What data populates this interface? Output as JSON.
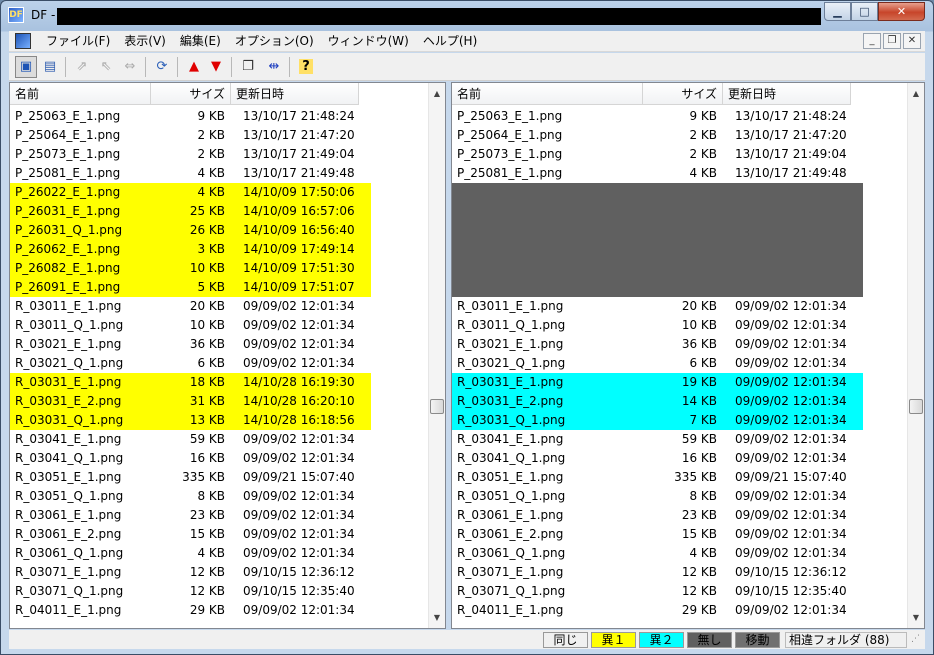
{
  "window": {
    "title": "DF -"
  },
  "menu": [
    "ファイル(F)",
    "表示(V)",
    "編集(E)",
    "オプション(O)",
    "ウィンドウ(W)",
    "ヘルプ(H)"
  ],
  "columns": {
    "name": "名前",
    "size": "サイズ",
    "date": "更新日時"
  },
  "left_rows": [
    {
      "name": "P_25063_E_1.png",
      "size": "9 KB",
      "date": "13/10/17 21:48:24",
      "state": "same"
    },
    {
      "name": "P_25064_E_1.png",
      "size": "2 KB",
      "date": "13/10/17 21:47:20",
      "state": "same"
    },
    {
      "name": "P_25073_E_1.png",
      "size": "2 KB",
      "date": "13/10/17 21:49:04",
      "state": "same"
    },
    {
      "name": "P_25081_E_1.png",
      "size": "4 KB",
      "date": "13/10/17 21:49:48",
      "state": "same"
    },
    {
      "name": "P_26022_E_1.png",
      "size": "4 KB",
      "date": "14/10/09 17:50:06",
      "state": "diff1"
    },
    {
      "name": "P_26031_E_1.png",
      "size": "25 KB",
      "date": "14/10/09 16:57:06",
      "state": "diff1"
    },
    {
      "name": "P_26031_Q_1.png",
      "size": "26 KB",
      "date": "14/10/09 16:56:40",
      "state": "diff1"
    },
    {
      "name": "P_26062_E_1.png",
      "size": "3 KB",
      "date": "14/10/09 17:49:14",
      "state": "diff1"
    },
    {
      "name": "P_26082_E_1.png",
      "size": "10 KB",
      "date": "14/10/09 17:51:30",
      "state": "diff1"
    },
    {
      "name": "P_26091_E_1.png",
      "size": "5 KB",
      "date": "14/10/09 17:51:07",
      "state": "diff1"
    },
    {
      "name": "R_03011_E_1.png",
      "size": "20 KB",
      "date": "09/09/02 12:01:34",
      "state": "same"
    },
    {
      "name": "R_03011_Q_1.png",
      "size": "10 KB",
      "date": "09/09/02 12:01:34",
      "state": "same"
    },
    {
      "name": "R_03021_E_1.png",
      "size": "36 KB",
      "date": "09/09/02 12:01:34",
      "state": "same"
    },
    {
      "name": "R_03021_Q_1.png",
      "size": "6 KB",
      "date": "09/09/02 12:01:34",
      "state": "same"
    },
    {
      "name": "R_03031_E_1.png",
      "size": "18 KB",
      "date": "14/10/28 16:19:30",
      "state": "diff1"
    },
    {
      "name": "R_03031_E_2.png",
      "size": "31 KB",
      "date": "14/10/28 16:20:10",
      "state": "diff1"
    },
    {
      "name": "R_03031_Q_1.png",
      "size": "13 KB",
      "date": "14/10/28 16:18:56",
      "state": "diff1"
    },
    {
      "name": "R_03041_E_1.png",
      "size": "59 KB",
      "date": "09/09/02 12:01:34",
      "state": "same"
    },
    {
      "name": "R_03041_Q_1.png",
      "size": "16 KB",
      "date": "09/09/02 12:01:34",
      "state": "same"
    },
    {
      "name": "R_03051_E_1.png",
      "size": "335 KB",
      "date": "09/09/21 15:07:40",
      "state": "same"
    },
    {
      "name": "R_03051_Q_1.png",
      "size": "8 KB",
      "date": "09/09/02 12:01:34",
      "state": "same"
    },
    {
      "name": "R_03061_E_1.png",
      "size": "23 KB",
      "date": "09/09/02 12:01:34",
      "state": "same"
    },
    {
      "name": "R_03061_E_2.png",
      "size": "15 KB",
      "date": "09/09/02 12:01:34",
      "state": "same"
    },
    {
      "name": "R_03061_Q_1.png",
      "size": "4 KB",
      "date": "09/09/02 12:01:34",
      "state": "same"
    },
    {
      "name": "R_03071_E_1.png",
      "size": "12 KB",
      "date": "09/10/15 12:36:12",
      "state": "same"
    },
    {
      "name": "R_03071_Q_1.png",
      "size": "12 KB",
      "date": "09/10/15 12:35:40",
      "state": "same"
    },
    {
      "name": "R_04011_E_1.png",
      "size": "29 KB",
      "date": "09/09/02 12:01:34",
      "state": "same"
    }
  ],
  "right_rows": [
    {
      "name": "P_25063_E_1.png",
      "size": "9 KB",
      "date": "13/10/17 21:48:24",
      "state": "same"
    },
    {
      "name": "P_25064_E_1.png",
      "size": "2 KB",
      "date": "13/10/17 21:47:20",
      "state": "same"
    },
    {
      "name": "P_25073_E_1.png",
      "size": "2 KB",
      "date": "13/10/17 21:49:04",
      "state": "same"
    },
    {
      "name": "P_25081_E_1.png",
      "size": "4 KB",
      "date": "13/10/17 21:49:48",
      "state": "same"
    },
    {
      "name": "",
      "size": "",
      "date": "",
      "state": "none"
    },
    {
      "name": "",
      "size": "",
      "date": "",
      "state": "none"
    },
    {
      "name": "",
      "size": "",
      "date": "",
      "state": "none"
    },
    {
      "name": "",
      "size": "",
      "date": "",
      "state": "none"
    },
    {
      "name": "",
      "size": "",
      "date": "",
      "state": "none"
    },
    {
      "name": "",
      "size": "",
      "date": "",
      "state": "none"
    },
    {
      "name": "R_03011_E_1.png",
      "size": "20 KB",
      "date": "09/09/02 12:01:34",
      "state": "same"
    },
    {
      "name": "R_03011_Q_1.png",
      "size": "10 KB",
      "date": "09/09/02 12:01:34",
      "state": "same"
    },
    {
      "name": "R_03021_E_1.png",
      "size": "36 KB",
      "date": "09/09/02 12:01:34",
      "state": "same"
    },
    {
      "name": "R_03021_Q_1.png",
      "size": "6 KB",
      "date": "09/09/02 12:01:34",
      "state": "same"
    },
    {
      "name": "R_03031_E_1.png",
      "size": "19 KB",
      "date": "09/09/02 12:01:34",
      "state": "diff2"
    },
    {
      "name": "R_03031_E_2.png",
      "size": "14 KB",
      "date": "09/09/02 12:01:34",
      "state": "diff2"
    },
    {
      "name": "R_03031_Q_1.png",
      "size": "7 KB",
      "date": "09/09/02 12:01:34",
      "state": "diff2"
    },
    {
      "name": "R_03041_E_1.png",
      "size": "59 KB",
      "date": "09/09/02 12:01:34",
      "state": "same"
    },
    {
      "name": "R_03041_Q_1.png",
      "size": "16 KB",
      "date": "09/09/02 12:01:34",
      "state": "same"
    },
    {
      "name": "R_03051_E_1.png",
      "size": "335 KB",
      "date": "09/09/21 15:07:40",
      "state": "same"
    },
    {
      "name": "R_03051_Q_1.png",
      "size": "8 KB",
      "date": "09/09/02 12:01:34",
      "state": "same"
    },
    {
      "name": "R_03061_E_1.png",
      "size": "23 KB",
      "date": "09/09/02 12:01:34",
      "state": "same"
    },
    {
      "name": "R_03061_E_2.png",
      "size": "15 KB",
      "date": "09/09/02 12:01:34",
      "state": "same"
    },
    {
      "name": "R_03061_Q_1.png",
      "size": "4 KB",
      "date": "09/09/02 12:01:34",
      "state": "same"
    },
    {
      "name": "R_03071_E_1.png",
      "size": "12 KB",
      "date": "09/10/15 12:36:12",
      "state": "same"
    },
    {
      "name": "R_03071_Q_1.png",
      "size": "12 KB",
      "date": "09/10/15 12:35:40",
      "state": "same"
    },
    {
      "name": "R_04011_E_1.png",
      "size": "29 KB",
      "date": "09/09/02 12:01:34",
      "state": "same"
    }
  ],
  "status": {
    "same": "同じ",
    "diff1": "異１",
    "diff2": "異２",
    "none": "無し",
    "moved": "移動",
    "summary": "相違フォルダ (88)"
  },
  "colors": {
    "diff1": "#ffff00",
    "diff2": "#00ffff",
    "none": "#606060"
  },
  "icons": [
    "app-icon",
    "open-folder-icon",
    "copy-left-icon",
    "copy-right-icon",
    "copy-both-icon",
    "refresh-icon",
    "up-diff-icon",
    "down-diff-icon",
    "properties-icon",
    "compare-icon",
    "help-icon"
  ]
}
